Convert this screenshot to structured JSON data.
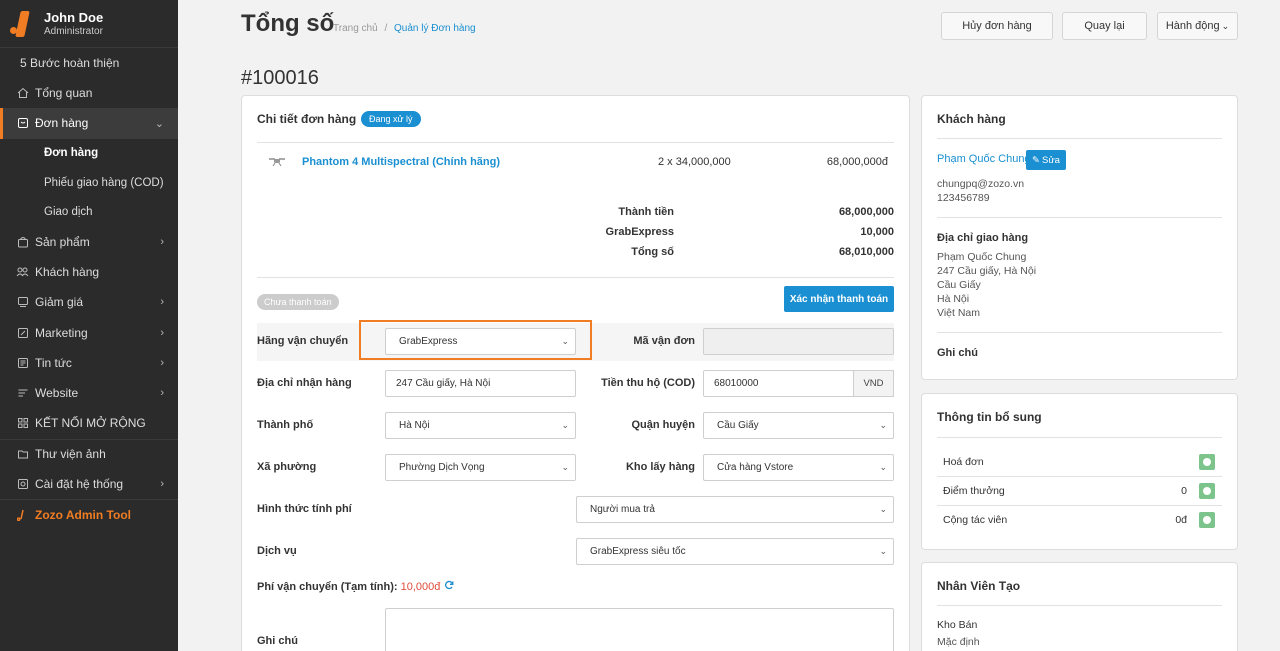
{
  "user": {
    "name": "John Doe",
    "role": "Administrator"
  },
  "sidebar": {
    "setup": "5 Bước hoàn thiện",
    "items": [
      {
        "label": "Tổng quan",
        "icon": "home-icon"
      },
      {
        "label": "Đơn hàng",
        "icon": "order-icon"
      },
      {
        "label": "Sản phẩm",
        "icon": "bag-icon"
      },
      {
        "label": "Khách hàng",
        "icon": "users-icon"
      },
      {
        "label": "Giảm giá",
        "icon": "discount-icon"
      },
      {
        "label": "Marketing",
        "icon": "marketing-icon"
      },
      {
        "label": "Tin tức",
        "icon": "news-icon"
      },
      {
        "label": "Website",
        "icon": "website-icon"
      },
      {
        "label": "KẾT NỐI MỞ RỘNG",
        "icon": "grid-icon"
      },
      {
        "label": "Thư viện ảnh",
        "icon": "folder-icon"
      },
      {
        "label": "Cài đặt hệ thống",
        "icon": "settings-icon"
      }
    ],
    "sub_items": [
      "Đơn hàng",
      "Phiếu giao hàng (COD)",
      "Giao dịch"
    ],
    "brand": "Zozo Admin Tool"
  },
  "header": {
    "title": "Tổng số",
    "breadcrumb_home": "Trang chủ",
    "breadcrumb_sep": "/",
    "breadcrumb_current": "Quản lý Đơn hàng",
    "cancel_btn": "Hủy đơn hàng",
    "back_btn": "Quay lại",
    "action_btn": "Hành động"
  },
  "order": {
    "id": "#100016",
    "detail_title": "Chi tiết đơn hàng",
    "status": "Đang xử lý",
    "product_name": "Phantom 4 Multispectral (Chính hãng)",
    "product_qty_price": "2 x 34,000,000",
    "product_total": "68,000,000đ",
    "subtotal_label": "Thành tiền",
    "subtotal_value": "68,000,000",
    "shipping_label": "GrabExpress",
    "shipping_value": "10,000",
    "total_label": "Tổng số",
    "total_value": "68,010,000",
    "payment_status": "Chưa thanh toán",
    "confirm_payment_btn": "Xác nhận thanh toán"
  },
  "form": {
    "carrier_label": "Hãng vận chuyển",
    "carrier_value": "GrabExpress",
    "tracking_label": "Mã vận đơn",
    "tracking_value": "",
    "address_label": "Địa chỉ nhận hàng",
    "address_value": "247 Cầu giấy, Hà Nội",
    "cod_label": "Tiền thu hộ (COD)",
    "cod_value": "68010000",
    "cod_unit": "VND",
    "city_label": "Thành phố",
    "city_value": "Hà Nội",
    "district_label": "Quận huyện",
    "district_value": "Cầu Giấy",
    "ward_label": "Xã phường",
    "ward_value": "Phường Dịch Vọng",
    "warehouse_label": "Kho lấy hàng",
    "warehouse_value": "Cửa hàng Vstore",
    "fee_method_label": "Hình thức tính phí",
    "fee_method_value": "Người mua trả",
    "service_label": "Dịch vụ",
    "service_value": "GrabExpress siêu tốc",
    "ship_fee_label": "Phí vận chuyển (Tạm tính):",
    "ship_fee_value": "10,000đ",
    "note_label": "Ghi chú"
  },
  "customer": {
    "title": "Khách hàng",
    "name": "Phạm Quốc Chung",
    "edit_btn": "Sửa",
    "email": "chungpq@zozo.vn",
    "phone": "123456789",
    "shipping_title": "Địa chỉ giao hàng",
    "ship_name": "Phạm Quốc Chung",
    "ship_street": "247 Cầu giấy, Hà Nội",
    "ship_district": "Cầu Giấy",
    "ship_city": "Hà Nội",
    "ship_country": "Việt Nam",
    "note_title": "Ghi chú"
  },
  "extra": {
    "title": "Thông tin bổ sung",
    "invoice_label": "Hoá đơn",
    "points_label": "Điểm thưởng",
    "points_value": "0",
    "affiliate_label": "Cộng tác viên",
    "affiliate_value": "0đ"
  },
  "staff": {
    "title": "Nhân Viên Tạo",
    "warehouse_label": "Kho Bán",
    "warehouse_value": "Mặc định"
  }
}
